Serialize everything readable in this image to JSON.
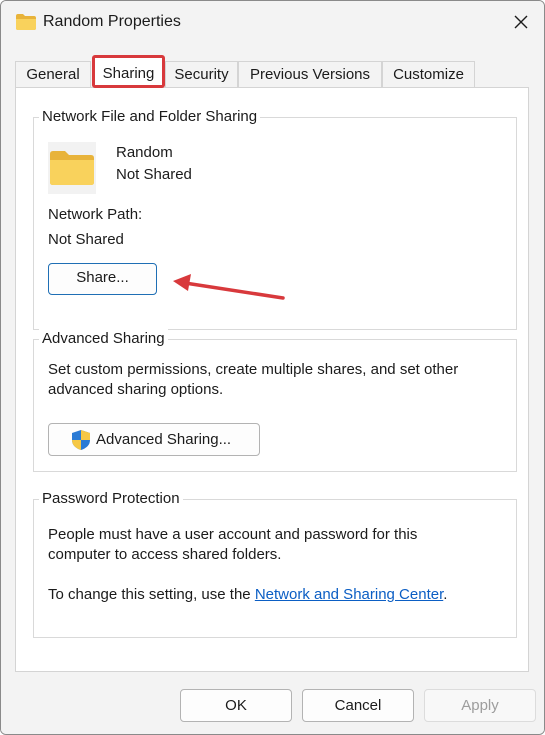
{
  "window": {
    "title": "Random Properties",
    "title_icon": "folder-icon",
    "close_icon": "close-icon"
  },
  "tabs": [
    {
      "label": "General",
      "active": false
    },
    {
      "label": "Sharing",
      "active": true
    },
    {
      "label": "Security",
      "active": false
    },
    {
      "label": "Previous Versions",
      "active": false
    },
    {
      "label": "Customize",
      "active": false
    }
  ],
  "network_sharing": {
    "legend": "Network File and Folder Sharing",
    "folder_icon": "folder-icon",
    "folder_name": "Random",
    "folder_status": "Not Shared",
    "path_label": "Network Path:",
    "path_value": "Not Shared",
    "share_button": "Share...",
    "annotation": "red-arrow-icon"
  },
  "advanced_sharing": {
    "legend": "Advanced Sharing",
    "description_line1": "Set custom permissions, create multiple shares, and set other",
    "description_line2": "advanced sharing options.",
    "button_icon": "uac-shield-icon",
    "button_label": "Advanced Sharing..."
  },
  "password_protection": {
    "legend": "Password Protection",
    "line1": "People must have a user account and password for this",
    "line2": "computer to access shared folders.",
    "line3_prefix": "To change this setting, use the ",
    "link_text": "Network and Sharing Center",
    "line3_suffix": "."
  },
  "footer": {
    "ok": "OK",
    "cancel": "Cancel",
    "apply": "Apply"
  },
  "colors": {
    "highlight": "#d8393c",
    "link": "#0b5ec4",
    "folder": "#f7c948"
  }
}
